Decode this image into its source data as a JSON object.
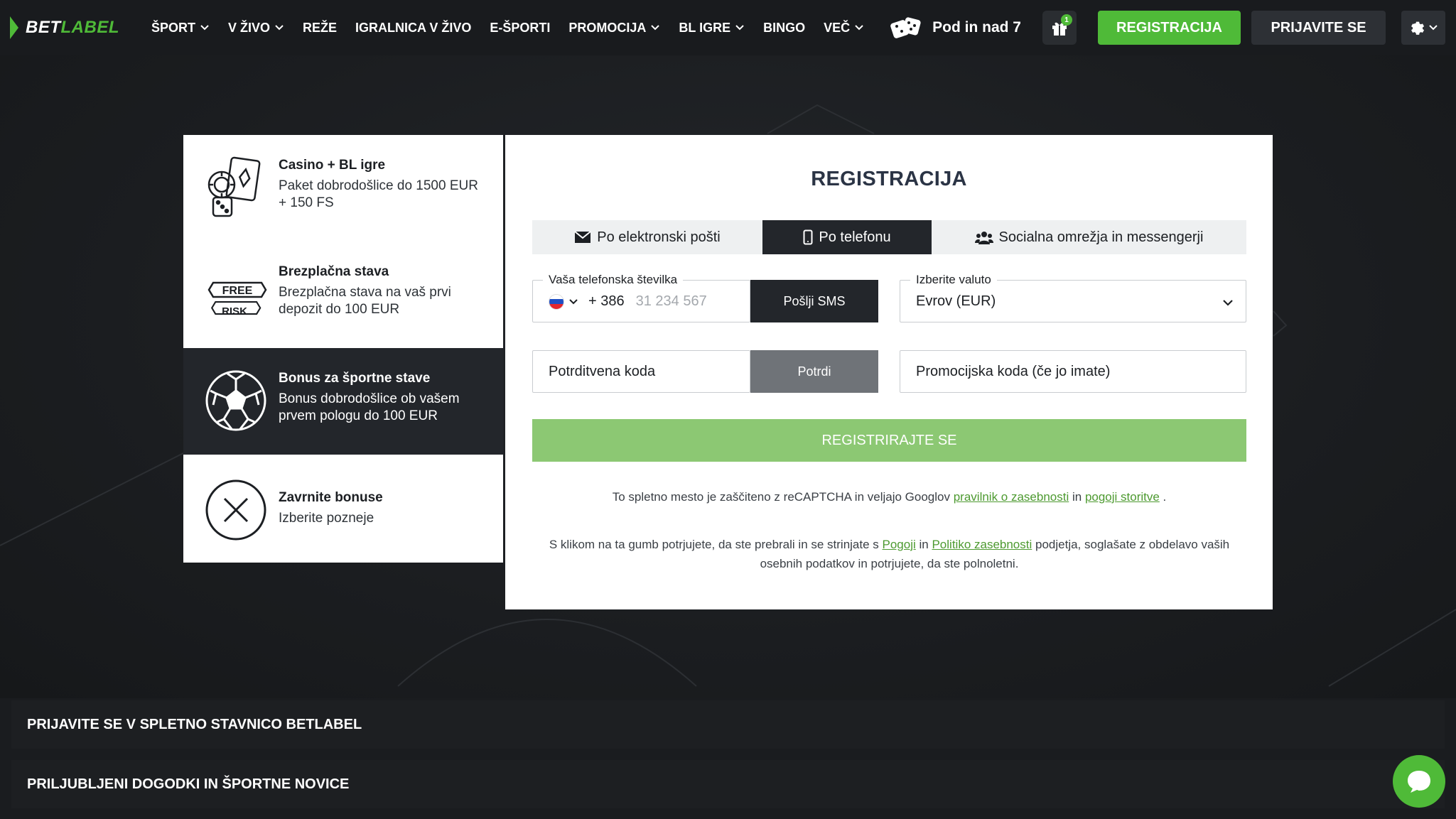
{
  "brand": {
    "logo_a": "BET",
    "logo_b": "LABEL",
    "accent": "#4fba38"
  },
  "nav": {
    "items": [
      {
        "label": "ŠPORT",
        "dropdown": true
      },
      {
        "label": "V ŽIVO",
        "dropdown": true
      },
      {
        "label": "REŽE",
        "dropdown": false
      },
      {
        "label": "IGRALNICA V ŽIVO",
        "dropdown": false
      },
      {
        "label": "E-ŠPORTI",
        "dropdown": false
      },
      {
        "label": "PROMOCIJA",
        "dropdown": true
      },
      {
        "label": "BL IGRE",
        "dropdown": true
      },
      {
        "label": "BINGO",
        "dropdown": false
      },
      {
        "label": "VEČ",
        "dropdown": true
      }
    ],
    "promo_label": "Pod in nad 7"
  },
  "header": {
    "gift_badge": "1",
    "register_label": "REGISTRACIJA",
    "login_label": "PRIJAVITE SE"
  },
  "bonuses": [
    {
      "title": "Casino + BL igre",
      "desc": "Paket dobrodošlice do 1500 EUR + 150 FS",
      "icon": "casino-chips-icon",
      "active": false
    },
    {
      "title": "Brezplačna stava",
      "desc": "Brezplačna stava na vaš prvi depozit do 100 EUR",
      "icon": "free-risk-icon",
      "active": false,
      "icon_text_1": "FREE",
      "icon_text_2": "RISK"
    },
    {
      "title": "Bonus za športne stave",
      "desc": "Bonus dobrodošlice ob vašem prvem pologu do 100 EUR",
      "icon": "soccer-ball-icon",
      "active": true
    },
    {
      "title": "Zavrnite bonuse",
      "desc": "Izberite pozneje",
      "icon": "close-circle-icon",
      "active": false
    }
  ],
  "form": {
    "title": "REGISTRACIJA",
    "tabs": [
      {
        "label": "Po elektronski pošti",
        "icon": "envelope-icon",
        "active": false
      },
      {
        "label": "Po telefonu",
        "icon": "phone-icon",
        "active": true
      },
      {
        "label": "Socialna omrežja in messengerji",
        "icon": "users-icon",
        "active": false
      }
    ],
    "phone_legend": "Vaša telefonska številka",
    "phone_prefix": "+ 386",
    "phone_placeholder": "31 234 567",
    "send_sms_label": "Pošlji SMS",
    "currency_legend": "Izberite valuto",
    "currency_value": "Evrov (EUR)",
    "confirm_placeholder": "Potrditvena koda",
    "confirm_button": "Potrdi",
    "promo_placeholder": "Promocijska koda (če jo imate)",
    "submit_label": "REGISTRIRAJTE SE",
    "note1": {
      "before": "To spletno mesto je zaščiteno z reCAPTCHA in veljajo Googlov ",
      "link1": "pravilnik o zasebnosti",
      "mid": " in ",
      "link2": "pogoji storitve",
      "after": " ."
    },
    "note2": {
      "before": "S klikom na ta gumb potrjujete, da ste prebrali in se strinjate s ",
      "link1": "Pogoji",
      "mid": " in ",
      "link2": "Politiko zasebnosti",
      "after": " podjetja, soglašate z obdelavo vaših osebnih podatkov in potrjujete, da ste polnoletni."
    }
  },
  "footer": {
    "section1": "PRIJAVITE SE V SPLETNO STAVNICO BETLABEL",
    "section2": "PRILJUBLJENI DOGODKI IN ŠPORTNE NOVICE"
  }
}
